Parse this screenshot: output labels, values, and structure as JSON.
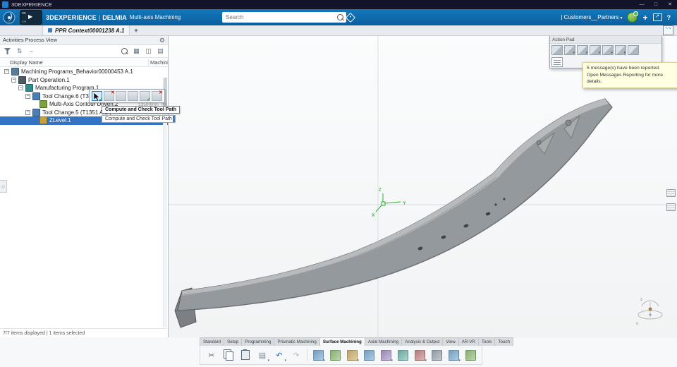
{
  "titlebar": {
    "app_title": "3DEXPERIENCE"
  },
  "icons": {
    "minimize": "—",
    "maximize": "□",
    "close": "✕",
    "play": "▶",
    "caret_down": "▾",
    "plus": "+",
    "share_arrow": "↗",
    "help": "?",
    "gear": "⚙",
    "expander_collapse": "−",
    "search": "⌕",
    "sort": "⇅",
    "grid": "▦",
    "list": "▤",
    "columns": "◫",
    "arrow_nw": "↖",
    "arrow_se": "↘",
    "diamond": "◇",
    "undo": "↶",
    "redo": "↷",
    "cut": "✂",
    "report": "▤"
  },
  "header": {
    "brand": "3DEXPERIENCE",
    "divider": "|",
    "app": "DELMIA",
    "module": "Multi-axis Machining",
    "search_placeholder": "Search",
    "account_label": "| Customers__Partners",
    "player_top": "3D",
    "player_bottom": "V.R"
  },
  "tabbar": {
    "active_tab": "PPR Context00001238 A.1"
  },
  "tree_panel": {
    "title": "Activities Process View",
    "columns": [
      "Display Name",
      "Machining fee"
    ],
    "items": [
      {
        "label": "Machining Programs_Behavior00000453 A.1",
        "level": 0,
        "expander": true,
        "icon": "machining-programs-icon",
        "icon_color": "#5a7d9c"
      },
      {
        "label": "Part Operation.1",
        "level": 1,
        "expander": true,
        "icon": "part-operation-icon",
        "icon_color": "#4c5a66"
      },
      {
        "label": "Manufacturing Program.1",
        "level": 2,
        "expander": true,
        "icon": "manufacturing-program-icon",
        "icon_color": "#2e8b8b"
      },
      {
        "label": "Tool Change.6 (T35",
        "level": 3,
        "expander": true,
        "icon": "tool-change-icon",
        "icon_color": "#4a7fb5"
      },
      {
        "label": "Multi-Axis Contour Driven.2",
        "level": 4,
        "expander": false,
        "icon": "machining-operation-icon",
        "icon_color": "#7ba23f"
      },
      {
        "label": "Tool Change.5 (T1351 A.1 ,",
        "level": 3,
        "expander": true,
        "icon": "tool-change-icon",
        "icon_color": "#4a7fb5"
      },
      {
        "label": "ZLevel.1",
        "level": 4,
        "expander": false,
        "icon": "zlevel-operation-icon",
        "icon_color": "#c8a23c",
        "selected": true
      }
    ],
    "status": "7/7 items displayed | 1 items selected"
  },
  "context_toolbar": {
    "feedrate_text": "13500mm_mn",
    "icons": [
      {
        "name": "compute-and-check-tool-path-icon",
        "hovered": true,
        "mark": "check"
      },
      {
        "name": "remove-tool-path-icon",
        "hovered": false,
        "mark": "x"
      },
      {
        "name": "replay-tool-path-icon",
        "hovered": false,
        "mark": "none"
      },
      {
        "name": "simulate-machine-icon",
        "hovered": false,
        "mark": "none"
      },
      {
        "name": "analyze-tool-path-icon",
        "hovered": false,
        "mark": "check"
      },
      {
        "name": "delete-operation-icon",
        "hovered": false,
        "mark": "x"
      }
    ]
  },
  "tooltip": {
    "title": "Compute and Check Tool Path",
    "description": "Compute and Check Tool Path"
  },
  "action_pad": {
    "title": "Action Pad",
    "row1_icons": [
      {
        "name": "setup-view-icon",
        "dropdown": false
      },
      {
        "name": "top-view-icon",
        "dropdown": true
      },
      {
        "name": "front-view-icon",
        "dropdown": true
      },
      {
        "name": "side-view-icon",
        "dropdown": true
      },
      {
        "name": "iso-view-icon",
        "dropdown": true
      },
      {
        "name": "rotate-view-icon",
        "dropdown": true
      },
      {
        "name": "machine-table-icon",
        "dropdown": false
      }
    ],
    "row2_icons": [
      {
        "name": "report-sheet-icon",
        "dropdown": false
      }
    ]
  },
  "notification": {
    "line1": "5 message(s) have been reported.",
    "line2": "Open Messages Reporting for more details."
  },
  "viewport": {
    "axis_x_label": "X",
    "axis_y_label": "Y",
    "axis_z_label": "Z",
    "compass_x_label": "x",
    "compass_z_label": "z",
    "axis_color": "#2fae2f",
    "model_color": "#94999d",
    "model_top_color": "#b7bbbe",
    "model_edge_color": "#5a5e62"
  },
  "ribbon": {
    "tabs": [
      "Standard",
      "Setup",
      "Programming",
      "Prismatic Machining",
      "Surface Machining",
      "Axial Machining",
      "Analysis & Output",
      "View",
      "AR-VR",
      "Tools",
      "Touch"
    ],
    "active_tab": "Surface Machining"
  },
  "bottom_toolbar": {
    "icons": [
      {
        "name": "cut-icon",
        "type": "glyph",
        "glyph": "✂",
        "color": "#5a6b7c"
      },
      {
        "name": "copy-icon",
        "type": "copy"
      },
      {
        "name": "paste-icon",
        "type": "paste"
      },
      {
        "name": "report-icon",
        "type": "glyph",
        "glyph": "▤",
        "color": "#7a8a99",
        "dropdown": true
      },
      {
        "name": "undo-icon",
        "type": "glyph",
        "glyph": "↶",
        "color": "#2f6fb3",
        "dropdown": true
      },
      {
        "name": "redo-icon",
        "type": "glyph",
        "glyph": "↷",
        "color": "#5a6b7c",
        "disabled": true
      },
      {
        "name": "separator",
        "type": "sep"
      },
      {
        "name": "update-toolpath-icon",
        "type": "tile",
        "color": "#6f9fc4",
        "dropdown": true
      },
      {
        "name": "zlevel-operation-icon",
        "type": "tile",
        "color": "#85b06a"
      },
      {
        "name": "sweeping-operation-icon",
        "type": "tile",
        "color": "#c2a35e",
        "dropdown": true
      },
      {
        "name": "contour-driven-icon",
        "type": "tile",
        "color": "#6f9fc4"
      },
      {
        "name": "spiral-milling-icon",
        "type": "tile",
        "color": "#9a86b8",
        "dropdown": true
      },
      {
        "name": "isoparametric-icon",
        "type": "tile",
        "color": "#68aa9e"
      },
      {
        "name": "toolpath-replay-icon",
        "type": "tile",
        "color": "#b87a7a",
        "dropdown": true
      },
      {
        "name": "simulation-icon",
        "type": "tile",
        "color": "#8f9aa4"
      },
      {
        "name": "stock-icon",
        "type": "tile",
        "color": "#6f9fc4",
        "dropdown": true
      },
      {
        "name": "analysis-icon",
        "type": "tile",
        "color": "#85b06a"
      }
    ]
  }
}
